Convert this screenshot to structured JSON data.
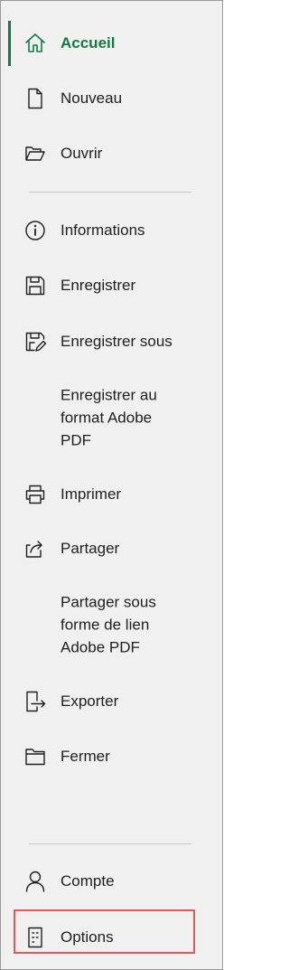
{
  "nav": {
    "accueil": "Accueil",
    "nouveau": "Nouveau",
    "ouvrir": "Ouvrir",
    "informations": "Informations",
    "enregistrer": "Enregistrer",
    "enregistrer_sous": "Enregistrer sous",
    "enregistrer_pdf": "Enregistrer au\nformat Adobe\nPDF",
    "imprimer": "Imprimer",
    "partager": "Partager",
    "partager_lien_pdf": "Partager sous\nforme de lien\nAdobe PDF",
    "exporter": "Exporter",
    "fermer": "Fermer",
    "compte": "Compte",
    "options": "Options"
  },
  "colors": {
    "accent": "#107c41",
    "highlight": "#e05a5a",
    "background": "#f0f0f0"
  },
  "icons": {
    "accueil": "home-icon",
    "nouveau": "new-document-icon",
    "ouvrir": "open-folder-icon",
    "informations": "info-icon",
    "enregistrer": "save-icon",
    "enregistrer_sous": "save-as-icon",
    "imprimer": "printer-icon",
    "partager": "share-icon",
    "exporter": "export-icon",
    "fermer": "close-folder-icon",
    "compte": "person-icon",
    "options": "options-icon"
  }
}
